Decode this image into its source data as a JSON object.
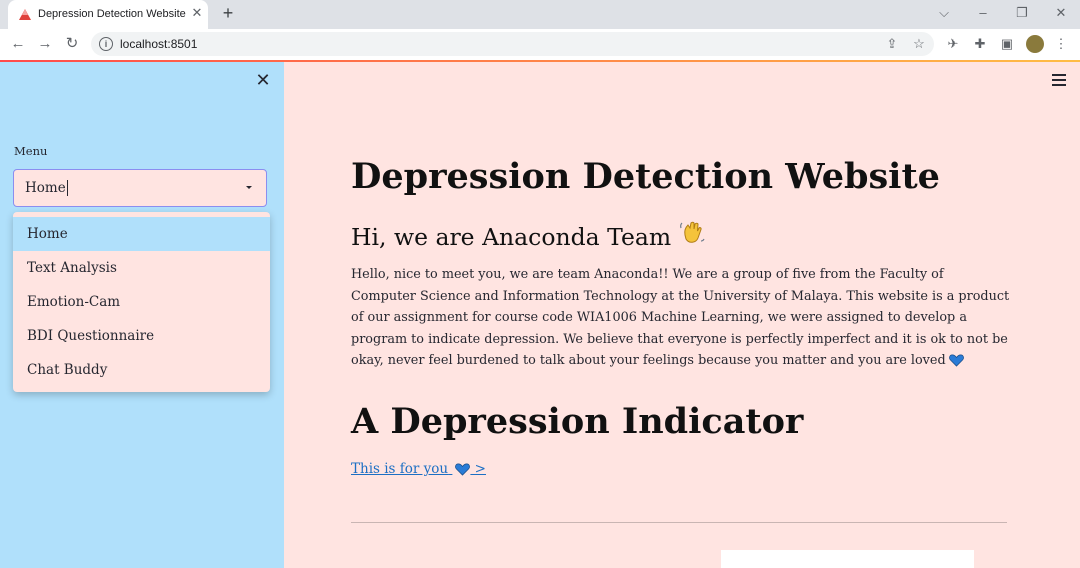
{
  "browser": {
    "tab_title": "Depression Detection Website",
    "url": "localhost:8501"
  },
  "sidebar": {
    "menu_label": "Menu",
    "selected_value": "Home",
    "options": [
      "Home",
      "Text Analysis",
      "Emotion-Cam",
      "BDI Questionnaire",
      "Chat Buddy"
    ]
  },
  "main": {
    "title": "Depression Detection Website",
    "subtitle": "Hi, we are Anaconda Team",
    "intro": "Hello, nice to meet you, we are team Anaconda!! We are a group of five from the Faculty of Computer Science and Information Technology at the University of Malaya. This website is a product of our assignment for course code WIA1006 Machine Learning, we were assigned to develop a program to indicate depression. We believe that everyone is perfectly imperfect and it is ok to not be okay, never feel burdened to talk about your feelings because you matter and you are loved",
    "section_title": "A Depression Indicator",
    "link_text": "This is for you",
    "link_suffix": " >"
  },
  "colors": {
    "sidebar_bg": "#b0e0fb",
    "main_bg": "#ffe4e1",
    "link": "#1c6fc4",
    "select_border": "#8b8ef0"
  }
}
